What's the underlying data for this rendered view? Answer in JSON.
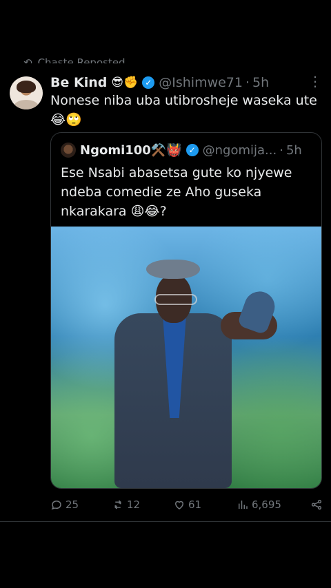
{
  "repost": {
    "icon": "repost-icon",
    "label": "Chaste Reposted"
  },
  "tweet": {
    "name": "Be Kind",
    "name_emojis": "😎✊",
    "verified_icon": "verified-badge-icon",
    "handle": "@Ishimwe71",
    "dot": "·",
    "time": "5h",
    "more": "⋮",
    "text_line1": "Nonese niba uba utibrosheje waseka ute",
    "text_line2": "😂🙄"
  },
  "quote": {
    "name": "Ngomi100⚒️👹",
    "verified_icon": "verified-badge-icon",
    "handle": "@ngomija...",
    "dot": "·",
    "time": "5h",
    "text_line1": "Ese Nsabi abasetsa gute ko njyewe",
    "text_line2": "ndeba comedie ze Aho guseka",
    "text_line3": "nkarakara 😩😂?"
  },
  "actions": {
    "replies": "25",
    "reposts": "12",
    "likes": "61",
    "views": "6,695",
    "share_icon": "share-icon"
  },
  "colors": {
    "background": "#000000",
    "text": "#e7e9ea",
    "muted": "#71767b",
    "verified": "#1d9bf0",
    "border": "#2f3336"
  }
}
